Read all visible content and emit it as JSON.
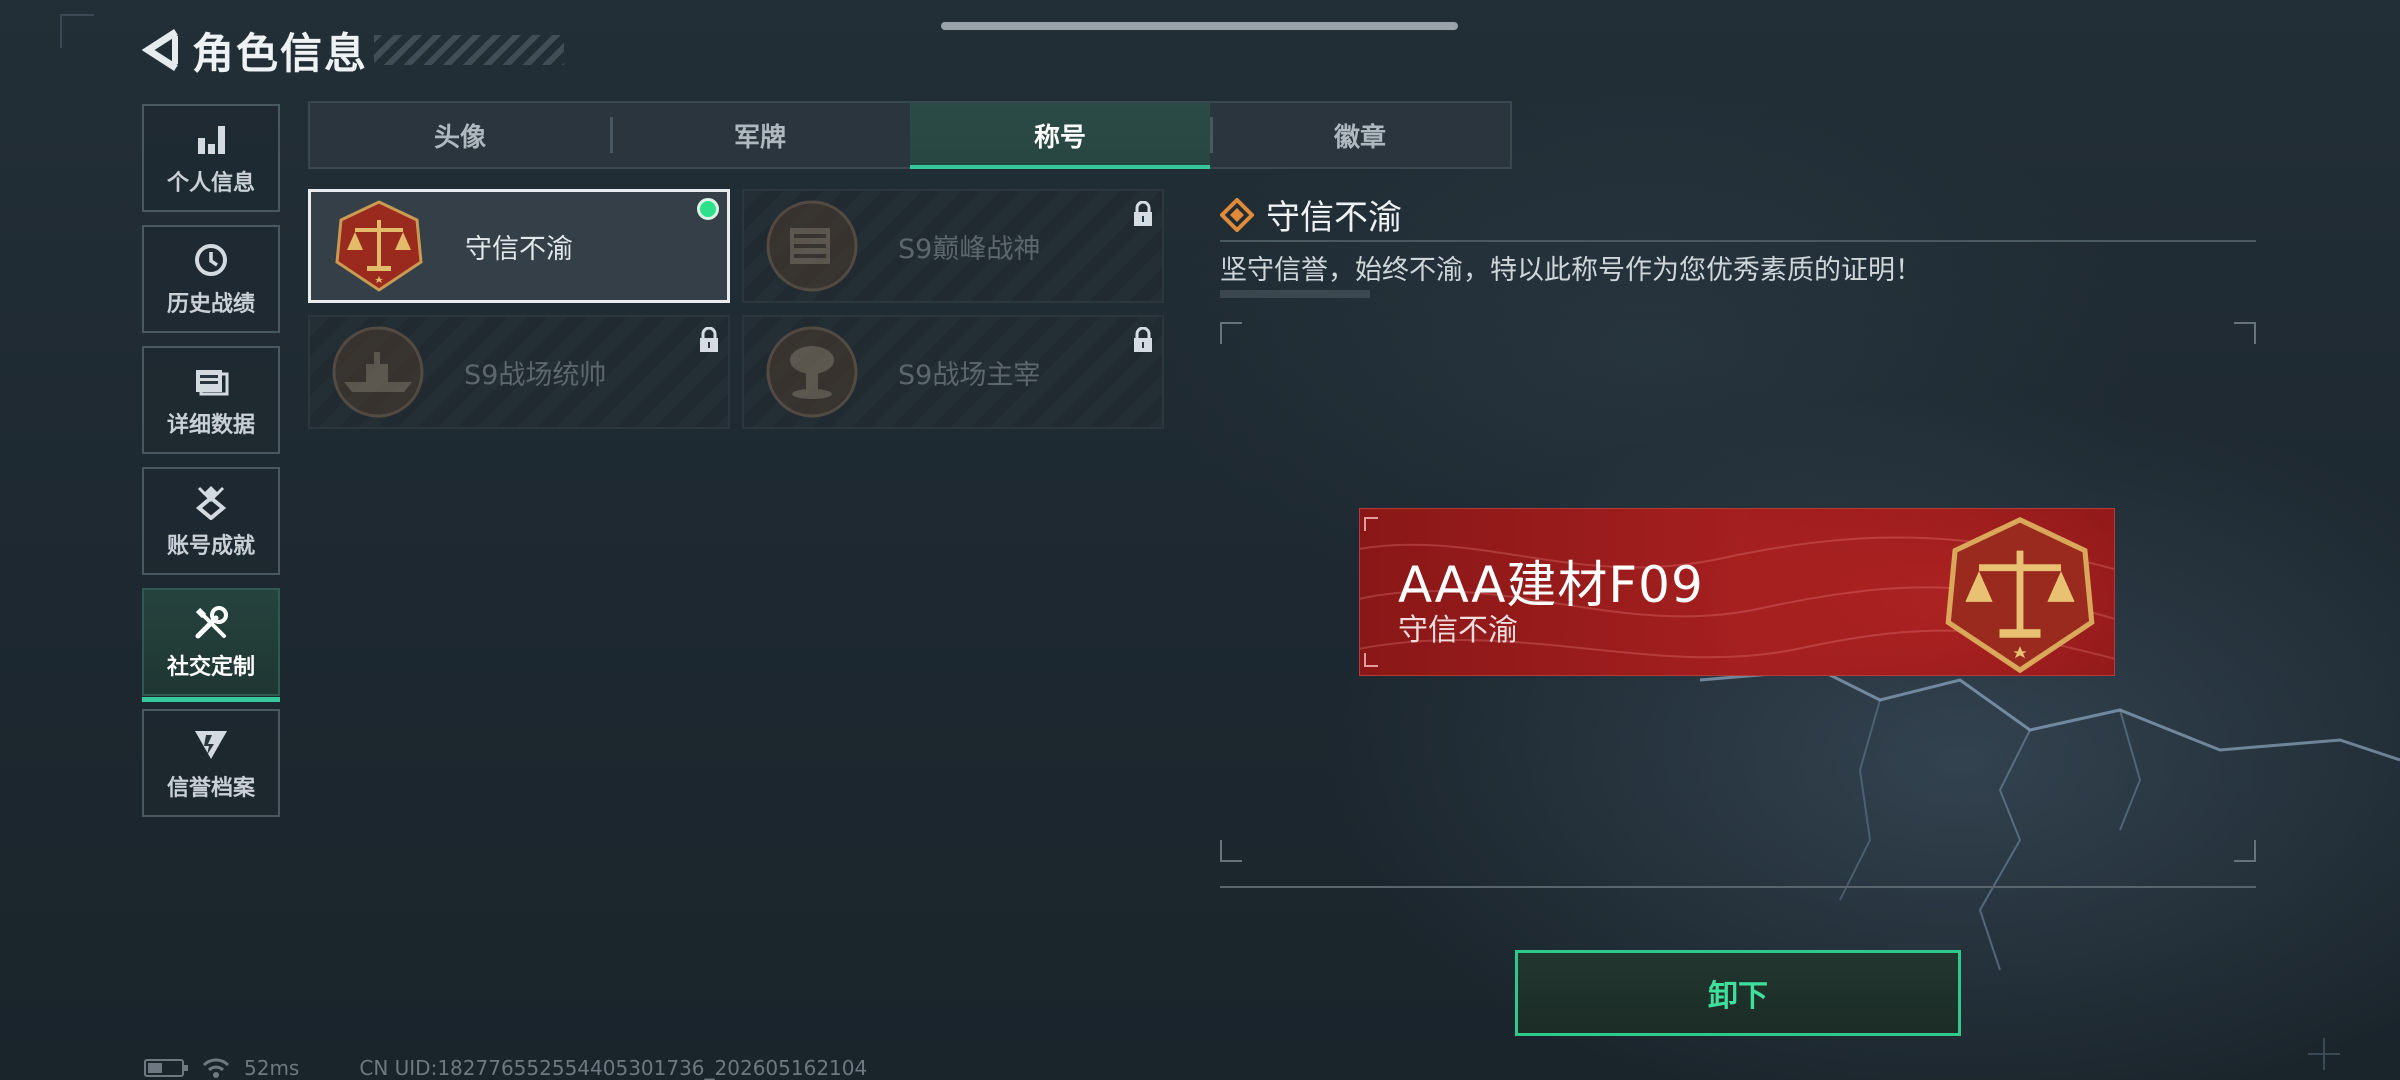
{
  "header": {
    "title": "角色信息"
  },
  "sidebar": {
    "items": [
      {
        "label": "个人信息",
        "icon": "bar-chart-icon"
      },
      {
        "label": "历史战绩",
        "icon": "clock-icon"
      },
      {
        "label": "详细数据",
        "icon": "folder-icon"
      },
      {
        "label": "账号成就",
        "icon": "achievement-icon"
      },
      {
        "label": "社交定制",
        "icon": "tools-icon",
        "active": true
      },
      {
        "label": "信誉档案",
        "icon": "shield-badge-icon"
      }
    ]
  },
  "tabs": [
    {
      "label": "头像"
    },
    {
      "label": "军牌"
    },
    {
      "label": "称号",
      "active": true
    },
    {
      "label": "徽章"
    }
  ],
  "titles": [
    {
      "name": "守信不渝",
      "state": "equipped",
      "emblem": "scales-emblem-icon"
    },
    {
      "name": "S9巅峰战神",
      "state": "locked",
      "emblem": "fortress-emblem-icon"
    },
    {
      "name": "S9战场统帅",
      "state": "locked",
      "emblem": "warship-emblem-icon"
    },
    {
      "name": "S9战场主宰",
      "state": "locked",
      "emblem": "mushroom-cloud-emblem-icon"
    }
  ],
  "detail": {
    "title": "守信不渝",
    "description": "坚守信誉，始终不渝，特以此称号作为您优秀素质的证明！"
  },
  "nameplate": {
    "player_name": "AAA建材F09",
    "title": "守信不渝",
    "color": "#a41f1f"
  },
  "actions": {
    "unequip": "卸下"
  },
  "status_bar": {
    "ping": "52ms",
    "uid": "CN UID:1827765525544053017​36_202605162104"
  },
  "colors": {
    "accent": "#35c89a",
    "equipped": "#2ee08a"
  }
}
